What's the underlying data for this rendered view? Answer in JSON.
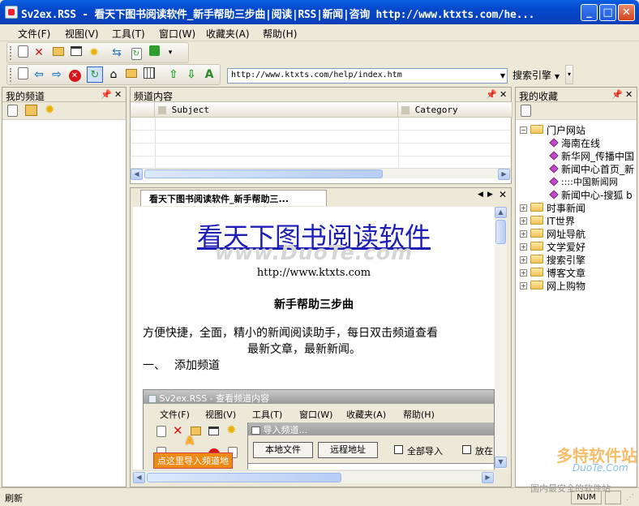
{
  "window": {
    "title": "Sv2ex.RSS - 看天下图书阅读软件_新手帮助三步曲|阅读|RSS|新闻|咨询 http://www.ktxts.com/he...",
    "minimize_icon": "minimize-icon",
    "maximize_icon": "maximize-icon",
    "close_icon": "close-icon"
  },
  "menu": [
    "文件(F)",
    "视图(V)",
    "工具(T)",
    "窗口(W)",
    "收藏夹(A)",
    "帮助(H)"
  ],
  "toolbar": {
    "address": "http://www.ktxts.com/help/index.htm",
    "search_engine": "搜索引擎"
  },
  "left_panel": {
    "title": "我的频道"
  },
  "channel_panel": {
    "title": "频道内容",
    "columns": [
      "Subject",
      "Category"
    ]
  },
  "document_tab": {
    "label": "看天下图书阅读软件_新手帮助三..."
  },
  "document": {
    "heading": "看天下图书阅读软件",
    "watermark": "www.DuoTe.com",
    "url": "http://www.ktxts.com",
    "subheading": "新手帮助三步曲",
    "paragraph_line1": "方便快捷，全面，精小的新闻阅读助手，每日双击频道查看",
    "paragraph_line2": "最新文章，最新新闻。",
    "step1_num": "一、",
    "step1_text": "添加频道",
    "shot": {
      "title": "Sv2ex.RSS - 查看频道内容",
      "menu": [
        "文件(F)",
        "视图(V)",
        "工具(T)",
        "窗口(W)",
        "收藏夹(A)",
        "帮助(H)"
      ],
      "dialog_title": "导入频道...",
      "local_file": "本地文件",
      "remote_address": "远程地址",
      "import_all": "全部导入",
      "put_in": "放在",
      "marker": "A",
      "tip": "点这里导入频道地"
    }
  },
  "favorites": {
    "title": "我的收藏",
    "tree": [
      {
        "label": "门户网站",
        "expanded": true,
        "children": [
          "海南在线",
          "新华网_传播中国",
          "新闻中心首页_新",
          "::::中国新闻网",
          "新闻中心-搜狐 b"
        ]
      },
      {
        "label": "时事新闻"
      },
      {
        "label": "IT世界"
      },
      {
        "label": "网址导航"
      },
      {
        "label": "文学爱好"
      },
      {
        "label": "搜索引擎"
      },
      {
        "label": "博客文章"
      },
      {
        "label": "网上购物"
      }
    ]
  },
  "status": {
    "text": "刷新",
    "num": "NUM",
    "corner_logo": "多特软件站",
    "corner_site": "DuoTe.Com",
    "corner_slogan": "国内最安全的软件站"
  }
}
